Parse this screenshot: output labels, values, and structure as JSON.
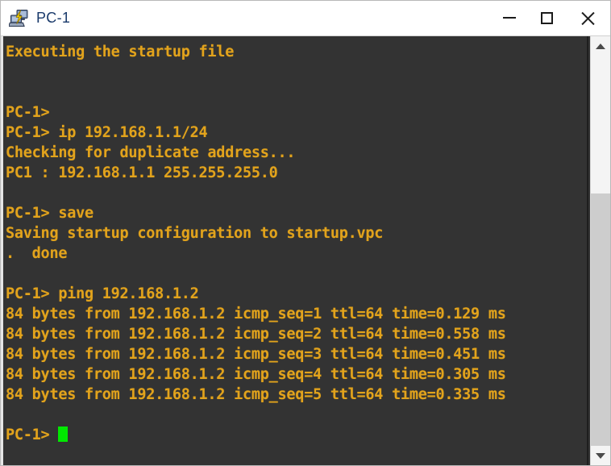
{
  "window": {
    "title": "PC-1",
    "icon": "computer-network-icon",
    "controls": {
      "minimize_label": "Minimize",
      "maximize_label": "Maximize",
      "close_label": "Close"
    }
  },
  "colors": {
    "terminal_bg": "#333333",
    "terminal_fg": "#e2a31c",
    "cursor": "#00e800",
    "titlebar_bg": "#ffffff",
    "title_fg": "#1a3a6b",
    "scrollbar_track": "#f4f4f4",
    "scrollbar_thumb": "#cdcdcd"
  },
  "terminal": {
    "prompt": "PC-1>",
    "cursor_visible": true,
    "lines": [
      "Executing the startup file",
      "",
      "",
      "PC-1>",
      "PC-1> ip 192.168.1.1/24",
      "Checking for duplicate address...",
      "PC1 : 192.168.1.1 255.255.255.0",
      "",
      "PC-1> save",
      "Saving startup configuration to startup.vpc",
      ".  done",
      "",
      "PC-1> ping 192.168.1.2",
      "84 bytes from 192.168.1.2 icmp_seq=1 ttl=64 time=0.129 ms",
      "84 bytes from 192.168.1.2 icmp_seq=2 ttl=64 time=0.558 ms",
      "84 bytes from 192.168.1.2 icmp_seq=3 ttl=64 time=0.451 ms",
      "84 bytes from 192.168.1.2 icmp_seq=4 ttl=64 time=0.305 ms",
      "84 bytes from 192.168.1.2 icmp_seq=5 ttl=64 time=0.335 ms",
      ""
    ],
    "last_line_prompt": "PC-1> "
  },
  "scrollbar": {
    "up_arrow": "chevron-up-icon",
    "down_arrow": "chevron-down-icon",
    "thumb_position_percent": 36
  }
}
